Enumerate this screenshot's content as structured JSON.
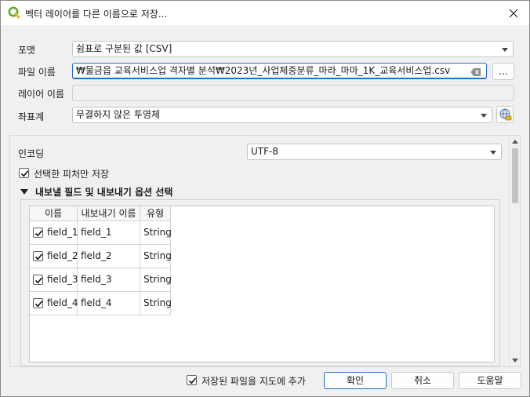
{
  "window": {
    "title": "벡터 레이어를 다른 이름으로 저장...",
    "accent_color": "#1f6fc9",
    "app_icon": "qgis-icon",
    "close_icon": "close-icon"
  },
  "form": {
    "format_label": "포맷",
    "format_value": "쉼표로 구분된 값 [CSV]",
    "filename_label": "파일 이름",
    "filename_value": "₩물금읍 교육서비스업 격자별 분석₩2023년_사업체중분류_마라_마마_1K_교육서비스업.csv",
    "browse_label": "…",
    "layername_label": "레이어 이름",
    "layername_value": "",
    "crs_label": "좌표계",
    "crs_value": "무결하지 않은 투영체"
  },
  "options": {
    "encoding_label": "인코딩",
    "encoding_value": "UTF-8",
    "selected_only_label": "선택한 피처만 저장",
    "selected_only_checked": true,
    "fields_group_title": "내보낼 필드 및 내보내기 옵션 선택",
    "fields_group_expanded": true
  },
  "table": {
    "headers": [
      "이름",
      "내보내기 이름",
      "유형"
    ],
    "rows": [
      {
        "checked": true,
        "name": "field_1",
        "export_name": "field_1",
        "type": "String"
      },
      {
        "checked": true,
        "name": "field_2",
        "export_name": "field_2",
        "type": "String"
      },
      {
        "checked": true,
        "name": "field_3",
        "export_name": "field_3",
        "type": "String"
      },
      {
        "checked": true,
        "name": "field_4",
        "export_name": "field_4",
        "type": "String"
      }
    ]
  },
  "footer": {
    "add_to_map_label": "저장된 파일을 지도에 추가",
    "add_to_map_checked": true,
    "ok_label": "확인",
    "cancel_label": "취소",
    "help_label": "도움말"
  }
}
